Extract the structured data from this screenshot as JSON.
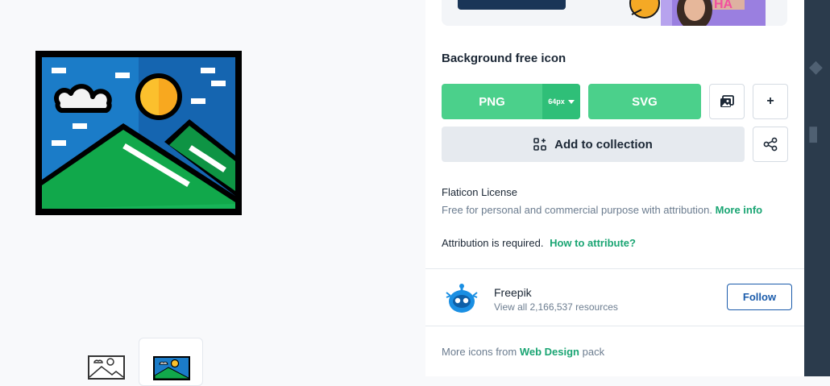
{
  "icon": {
    "title": "Background free icon"
  },
  "download": {
    "png_label": "PNG",
    "size_label": "64px",
    "svg_label": "SVG",
    "plus_label": "+",
    "collection_label": "Add to collection"
  },
  "license": {
    "title": "Flaticon License",
    "description": "Free for personal and commercial purpose with attribution.",
    "more_info": "More info",
    "attribution_text": "Attribution is required.",
    "how_to_attribute": "How to attribute?"
  },
  "author": {
    "name": "Freepik",
    "resources": "View all 2,166,537 resources",
    "follow_label": "Follow"
  },
  "pack": {
    "prefix": "More icons from",
    "name": "Web Design",
    "suffix": "pack"
  },
  "colors": {
    "green": "#4bd08b",
    "green_dark": "#2fbf78",
    "link_green": "#1aa573",
    "follow_blue": "#1a5bab",
    "sky_blue": "#1b7cc8",
    "hill_green": "#11a84b"
  },
  "icons": [
    "landscape-icon",
    "image-edit-icon",
    "collection-icon",
    "share-icon",
    "freepik-avatar-icon"
  ]
}
